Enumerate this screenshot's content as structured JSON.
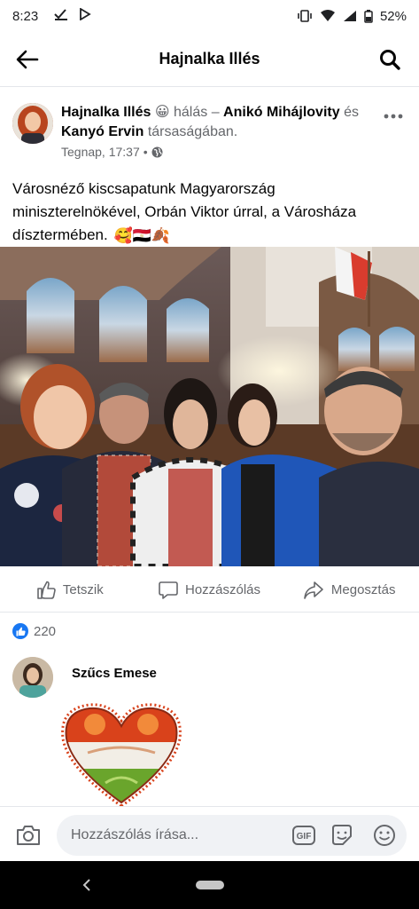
{
  "status_bar": {
    "time": "8:23",
    "battery": "52%"
  },
  "header": {
    "title": "Hajnalka Illés"
  },
  "post": {
    "author": "Hajnalka Illés",
    "feeling_emoji": "😀",
    "feeling": "hálás",
    "separator": "–",
    "tagged_1": "Anikó Mihájlovity",
    "and_word": "és",
    "tagged_2": "Kanyó Ervin",
    "company_suffix": "társaságában.",
    "timestamp": "Tegnap, 17:37",
    "dot": "•",
    "text": "Városnéző kiscsapatunk Magyarország miniszterelnökével, Orbán Viktor úrral, a Városháza dísztermében.",
    "text_emojis": "🥰🇪🇬🍂"
  },
  "actions": {
    "like": "Tetszik",
    "comment": "Hozzászólás",
    "share": "Megosztás"
  },
  "reactions": {
    "count": "220"
  },
  "comment": {
    "name": "Szűcs Emese"
  },
  "composer": {
    "placeholder": "Hozzászólás írása..."
  },
  "colors": {
    "facebook_blue": "#1877f2",
    "secondary_text": "#65676b",
    "heart_red": "#d9421b",
    "heart_green": "#6aa52c"
  }
}
